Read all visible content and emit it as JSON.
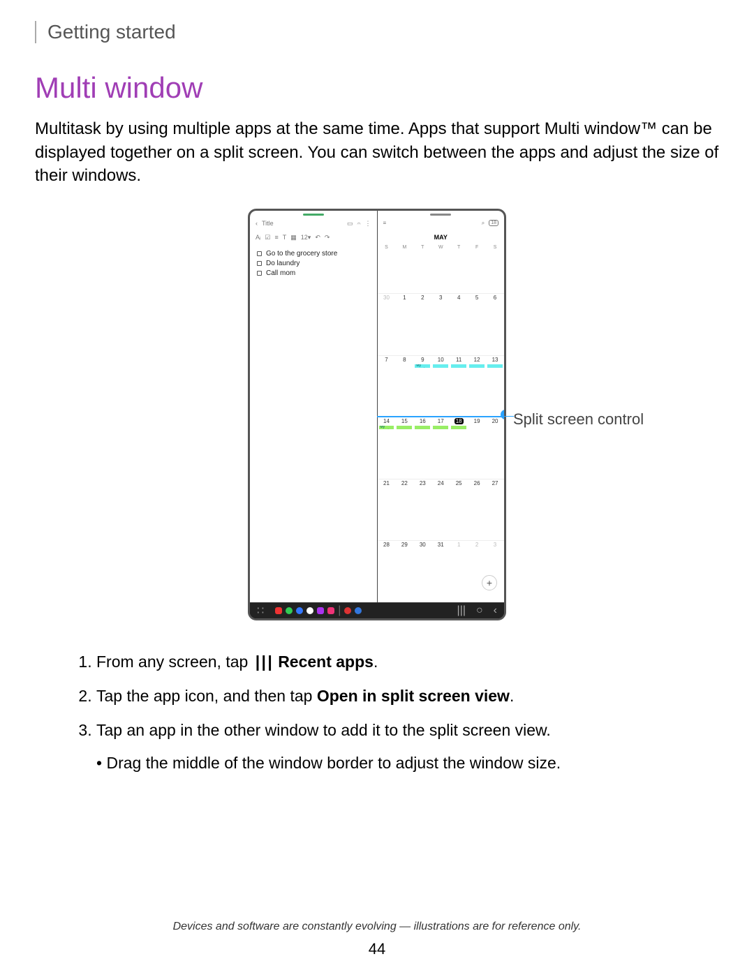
{
  "breadcrumb": "Getting started",
  "title": "Multi window",
  "intro_text": "Multitask by using multiple apps at the same time. Apps that support Multi window™ can be displayed together on a split screen. You can switch between the apps and adjust the size of their windows.",
  "callout_label": "Split screen control",
  "notes_app": {
    "title_placeholder": "Title",
    "items": [
      "Go to the grocery store",
      "Do laundry",
      "Call mom"
    ],
    "toolbar_text": "12"
  },
  "calendar_app": {
    "month": "MAY",
    "day_headers": [
      "S",
      "M",
      "T",
      "W",
      "T",
      "F",
      "S"
    ],
    "weeks": [
      [
        "30",
        "1",
        "2",
        "3",
        "4",
        "5",
        "6"
      ],
      [
        "7",
        "8",
        "9",
        "10",
        "11",
        "12",
        "13"
      ],
      [
        "14",
        "15",
        "16",
        "17",
        "18",
        "19",
        "20"
      ],
      [
        "21",
        "22",
        "23",
        "24",
        "25",
        "26",
        "27"
      ],
      [
        "28",
        "29",
        "30",
        "31",
        "1",
        "2",
        "3"
      ]
    ],
    "event_label": "My event",
    "today": "18",
    "fab": "+"
  },
  "steps": {
    "s1_pre": "From any screen, tap ",
    "s1_bold": "Recent apps",
    "s1_post": ".",
    "s2_pre": "Tap the app icon, and then tap ",
    "s2_bold": "Open in split screen view",
    "s2_post": ".",
    "s3": "Tap an app in the other window to add it to the split screen view.",
    "s3_sub": "Drag the middle of the window border to adjust the window size."
  },
  "footer_note": "Devices and software are constantly evolving — illustrations are for reference only.",
  "page_number": "44"
}
